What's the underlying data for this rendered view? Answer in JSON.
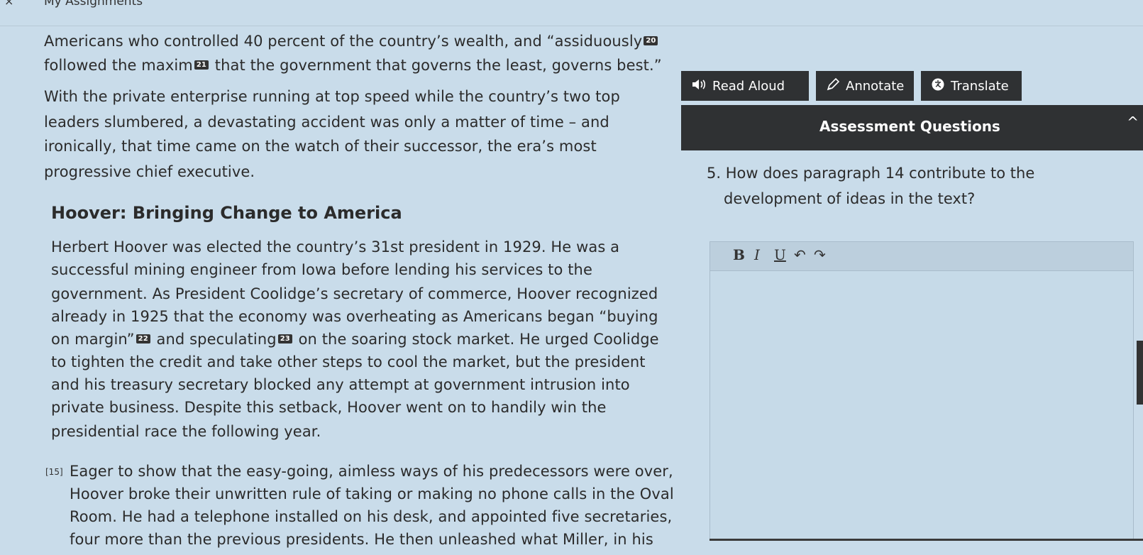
{
  "header": {
    "close_icon": "×",
    "title": "My Assignments"
  },
  "reading": {
    "lines_top": [
      {
        "pre": "Americans who controlled 40 percent of the country’s wealth, and “assiduously",
        "fn": "20",
        "post": ""
      },
      {
        "pre": "followed the maxim",
        "fn": "21",
        "post": " that the government that governs the least, governs best.”"
      }
    ],
    "para2": [
      "With the private enterprise running at top speed while the country’s two top",
      "leaders slumbered, a devastating accident was only a matter of time – and",
      "ironically, that time came on the watch of their successor, the era’s most",
      "progressive chief executive."
    ],
    "heading": "Hoover: Bringing Change to America",
    "para3_lines": [
      {
        "pre": "Herbert Hoover was elected the country’s 31st president in 1929. He was a"
      },
      {
        "pre": "successful mining engineer from Iowa before lending his services to the"
      },
      {
        "pre": "government. As President Coolidge’s secretary of commerce, Hoover recognized"
      },
      {
        "pre": "already in 1925 that the economy was overheating as Americans began “buying"
      },
      {
        "pre": "on margin”",
        "fn": "22",
        "mid": " and speculating",
        "fn2": "23",
        "post": " on the soaring stock market. He urged Coolidge"
      },
      {
        "pre": "to tighten the credit and take other steps to cool the market, but the president"
      },
      {
        "pre": "and his treasury secretary blocked any attempt at government intrusion into"
      },
      {
        "pre": "private business. Despite this setback, Hoover went on to handily win the"
      },
      {
        "pre": "presidential race the following year."
      }
    ],
    "para_num": "[15]",
    "para4": [
      "Eager to show that the easy-going, aimless ways of his predecessors were over,",
      "Hoover broke their unwritten rule of taking or making no phone calls in the Oval",
      "Room. He had a telephone installed on his desk, and appointed five secretaries,",
      "four more than the previous presidents. He then unleashed what Miller, in his"
    ]
  },
  "tools": {
    "read_aloud": {
      "icon": "speaker-icon",
      "label": "Read Aloud"
    },
    "annotate": {
      "icon": "pencil-icon",
      "label": "Annotate"
    },
    "translate": {
      "icon": "globe-icon",
      "label": "Translate"
    }
  },
  "assessment": {
    "title": "Assessment Questions",
    "question_lines": [
      "5. How does paragraph 14 contribute to the",
      "development of ideas in the text?"
    ]
  },
  "editor": {
    "bold": "B",
    "italic": "I",
    "underline": "U",
    "undo": "↶",
    "redo": "↷"
  }
}
